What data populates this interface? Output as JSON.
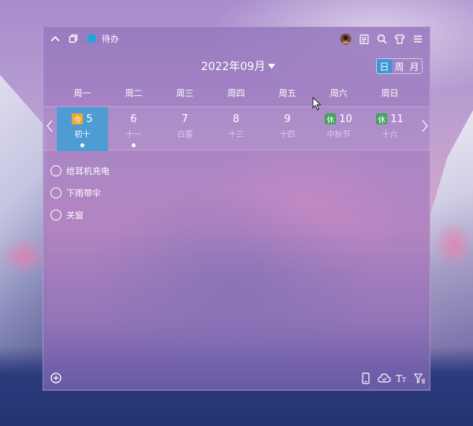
{
  "toolbar": {
    "category_label": "待办",
    "category_color": "#1ea6d8"
  },
  "header": {
    "month_title": "2022年09月",
    "view_day": "日",
    "view_week": "周",
    "view_month": "月",
    "active_view": "日"
  },
  "weekdays": [
    "周一",
    "周二",
    "周三",
    "周四",
    "周五",
    "周六",
    "周日"
  ],
  "days": [
    {
      "num": "5",
      "lunar": "初十",
      "badge": "今",
      "today": true,
      "dot": true
    },
    {
      "num": "6",
      "lunar": "十一",
      "badge": "",
      "today": false,
      "dot": true
    },
    {
      "num": "7",
      "lunar": "白露",
      "badge": "",
      "today": false,
      "dot": false
    },
    {
      "num": "8",
      "lunar": "十三",
      "badge": "",
      "today": false,
      "dot": false
    },
    {
      "num": "9",
      "lunar": "十四",
      "badge": "",
      "today": false,
      "dot": false
    },
    {
      "num": "10",
      "lunar": "中秋节",
      "badge": "休",
      "today": false,
      "dot": false
    },
    {
      "num": "11",
      "lunar": "十六",
      "badge": "休",
      "today": false,
      "dot": false
    }
  ],
  "todos": [
    {
      "text": "给耳机充电"
    },
    {
      "text": "下雨带伞"
    },
    {
      "text": "关窗"
    }
  ],
  "icons": {
    "collapse": "chevron-up-icon",
    "window": "window-icon",
    "avatar": "avatar",
    "notes": "notes-icon",
    "search": "search-icon",
    "skin": "shirt-icon",
    "menu": "menu-icon",
    "add": "add-icon",
    "phone": "phone-icon",
    "cloud": "cloud-sync-icon",
    "font": "font-size-icon",
    "filter": "filter-icon"
  }
}
